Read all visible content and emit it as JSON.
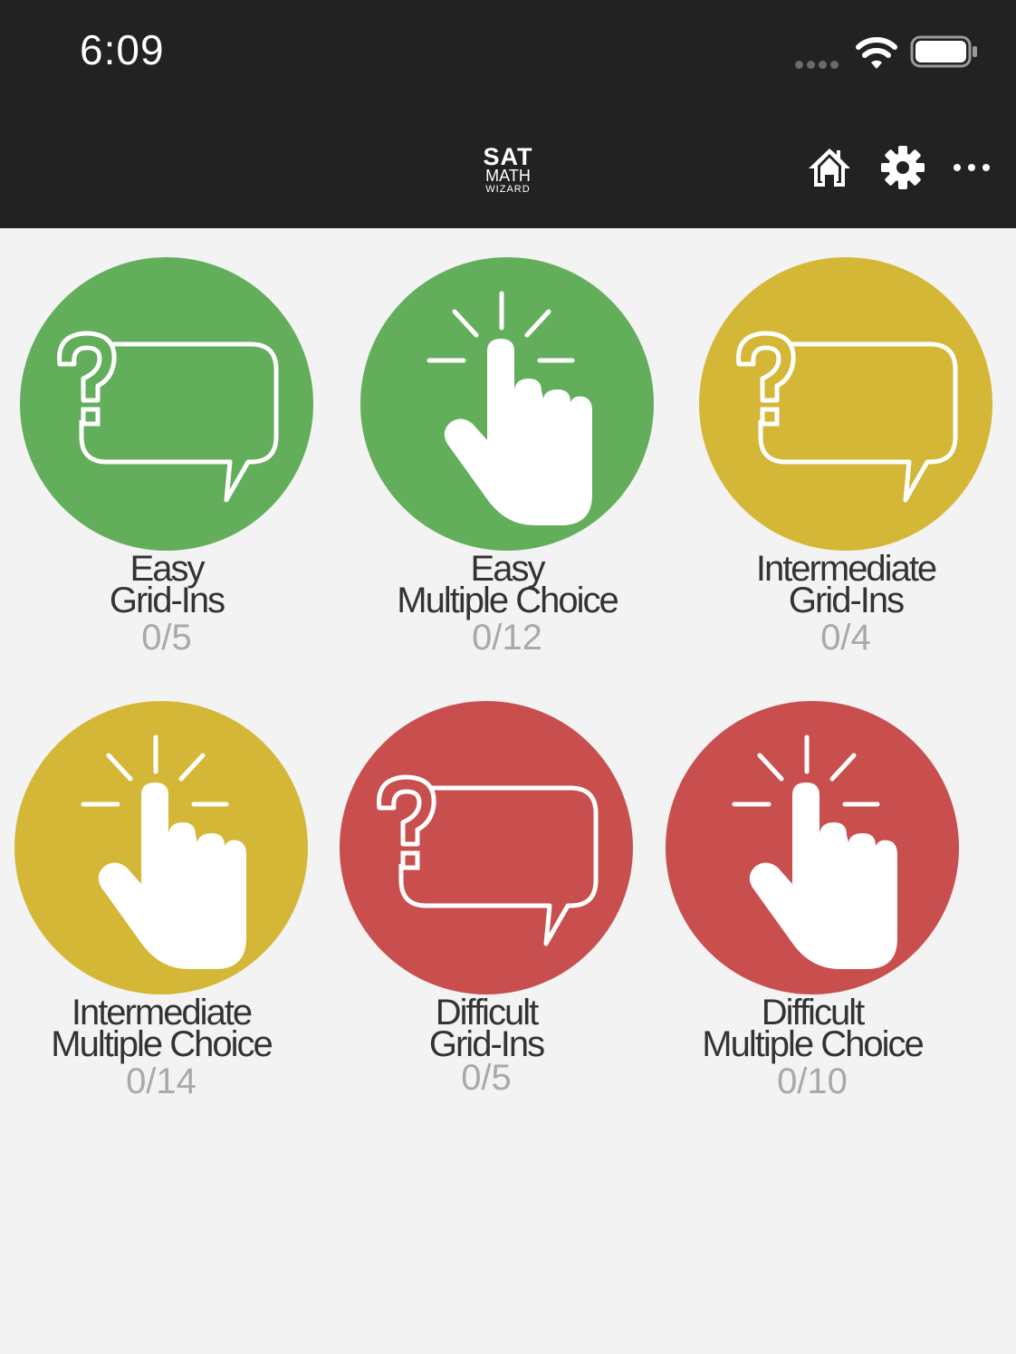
{
  "status_bar": {
    "time": "6:09"
  },
  "nav": {
    "logo": {
      "line1": "SAT",
      "line2": "MATH",
      "line3": "WIZARD"
    },
    "icons": [
      "home-icon",
      "gear-icon",
      "more-icon"
    ]
  },
  "colors": {
    "easy": "#62ae5b",
    "intermediate": "#d4b736",
    "difficult": "#c94f4f",
    "bar": "#222222",
    "background": "#f3f3f3"
  },
  "tiles": [
    {
      "difficulty": "Easy",
      "type": "Grid-Ins",
      "score": "0/5",
      "icon": "question-bubble-icon"
    },
    {
      "difficulty": "Easy",
      "type": "Multiple Choice",
      "score": "0/12",
      "icon": "pointing-hand-icon"
    },
    {
      "difficulty": "Intermediate",
      "type": "Grid-Ins",
      "score": "0/4",
      "icon": "question-bubble-icon"
    },
    {
      "difficulty": "Intermediate",
      "type": "Multiple Choice",
      "score": "0/14",
      "icon": "pointing-hand-icon"
    },
    {
      "difficulty": "Difficult",
      "type": "Grid-Ins",
      "score": "0/5",
      "icon": "question-bubble-icon"
    },
    {
      "difficulty": "Difficult",
      "type": "Multiple Choice",
      "score": "0/10",
      "icon": "pointing-hand-icon"
    }
  ]
}
